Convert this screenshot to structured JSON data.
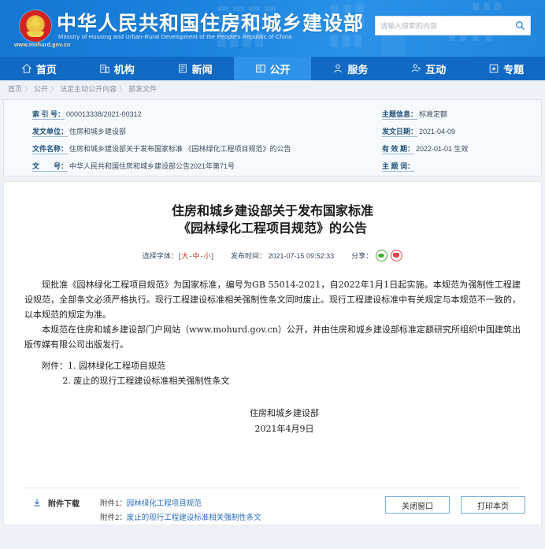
{
  "header": {
    "emblem_icon": "national-emblem-icon",
    "title": "中华人民共和国住房和城乡建设部",
    "subtitle": "Ministry of Housing and Urban-Rural Development of the People's Republic of China",
    "url": "www.mohurd.gov.cn",
    "search": {
      "placeholder": "请输入搜索的内容",
      "value": "",
      "icon": "search-icon"
    }
  },
  "nav": {
    "items": [
      {
        "label": "首页",
        "icon": "home-icon",
        "active": false
      },
      {
        "label": "机构",
        "icon": "building-icon",
        "active": false
      },
      {
        "label": "新闻",
        "icon": "news-icon",
        "active": false
      },
      {
        "label": "公开",
        "icon": "open-info-icon",
        "active": true
      },
      {
        "label": "服务",
        "icon": "user-service-icon",
        "active": false
      },
      {
        "label": "互动",
        "icon": "interaction-icon",
        "active": false
      },
      {
        "label": "专题",
        "icon": "star-topic-icon",
        "active": false
      }
    ]
  },
  "breadcrumb": {
    "items": [
      "首页",
      "公开",
      "法定主动公开内容",
      "部发文件"
    ],
    "separator": "〉"
  },
  "meta": {
    "left": [
      {
        "label": "索 引 号：",
        "value": "000013338/2021-00312"
      },
      {
        "label": "发文单位：",
        "value": "住房和城乡建设部"
      },
      {
        "label": "文件名称：",
        "value": "住房和城乡建设部关于发布国家标准 《园林绿化工程项目规范》的公告"
      },
      {
        "label": "文　　号：",
        "value": "中华人民共和国住房和城乡建设部公告2021年第71号"
      }
    ],
    "right": [
      {
        "label": "主题信息：",
        "value": "标准定额"
      },
      {
        "label": "发文日期：",
        "value": "2021-04-09"
      },
      {
        "label": "有 效 期：",
        "value": "2022-01-01 生效"
      },
      {
        "label": "主 题 词：",
        "value": ""
      }
    ]
  },
  "document": {
    "title_line1": "住房和城乡建设部关于发布国家标准",
    "title_line2": "《园林绿化工程项目规范》的公告",
    "toolbar": {
      "font_label": "选择字体：",
      "bracket_open": "[",
      "bracket_close": "]",
      "font_large": "大",
      "font_medium": "中",
      "font_small": "小",
      "dash": "-",
      "publish_label": "发布时间：",
      "publish_time": "2021-07-15 09:52:33",
      "share_label": "分享：",
      "share_icons": [
        "wechat-share-icon",
        "weibo-share-icon"
      ]
    },
    "paragraphs": [
      "现批准《园林绿化工程项目规范》为国家标准，编号为GB 55014-2021，自2022年1月1日起实施。本规范为强制性工程建设规范，全部条文必须严格执行。现行工程建设标准相关强制性条文同时废止。现行工程建设标准中有关规定与本规范不一致的，以本规范的规定为准。",
      "本规范在住房和城乡建设部门户网站（www.mohurd.gov.cn）公开，并由住房和城乡建设部标准定额研究所组织中国建筑出版传媒有限公司出版发行。"
    ],
    "attachments_inline": {
      "label": "附件：",
      "item1": "1. 园林绿化工程项目规范",
      "item2": "2. 废止的现行工程建设标准相关强制性条文"
    },
    "signature": {
      "org": "住房和城乡建设部",
      "date": "2021年4月9日"
    },
    "download": {
      "icon": "download-icon",
      "label": "附件下载",
      "items": [
        {
          "num": "附件1：",
          "name": "园林绿化工程项目规范"
        },
        {
          "num": "附件2：",
          "name": "废止的现行工程建设标准相关强制性条文"
        }
      ]
    },
    "buttons": {
      "close": "关闭窗口",
      "print": "打印本页"
    }
  },
  "colors": {
    "header_blue": "#1b82dd",
    "nav_blue": "#1169c4",
    "nav_active": "#2f93e8",
    "link_blue": "#2a6ebb",
    "meta_label": "#23527c",
    "accent_red": "#c0392b",
    "wechat_green": "#3fae36",
    "weibo_red": "#e2464a"
  }
}
